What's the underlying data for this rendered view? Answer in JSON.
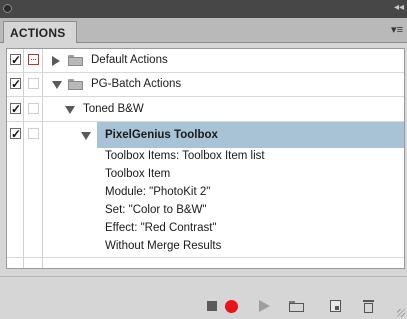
{
  "panel": {
    "tab_label": "ACTIONS",
    "collapse_glyph": "◂◂",
    "menu_glyph": "▾≡"
  },
  "rows": [
    {
      "label": "Default Actions",
      "checked": true,
      "dialog": "red",
      "expanded": false,
      "type": "set"
    },
    {
      "label": "PG-Batch Actions",
      "checked": true,
      "dialog": "empty",
      "expanded": true,
      "type": "set"
    },
    {
      "label": "Toned B&W",
      "checked": true,
      "dialog": "empty",
      "expanded": true,
      "type": "action"
    },
    {
      "label": "PixelGenius Toolbox",
      "checked": true,
      "dialog": "empty",
      "expanded": true,
      "type": "step",
      "selected": true
    },
    {
      "label": "Toolbox Items: Toolbox Item list",
      "type": "detail"
    },
    {
      "label": "Toolbox Item",
      "type": "detail"
    },
    {
      "label": "Module:  \"PhotoKit 2\"",
      "type": "detail"
    },
    {
      "label": "Set:  \"Color to B&W\"",
      "type": "detail"
    },
    {
      "label": "Effect:  \"Red Contrast\"",
      "type": "detail"
    },
    {
      "label": "Without Merge Results",
      "type": "detail"
    }
  ],
  "toolbar": {
    "stop_icon": "stop-icon",
    "record_icon": "record-icon",
    "play_icon": "play-icon",
    "new_set_icon": "folder-icon",
    "new_action_icon": "new-action-icon",
    "delete_icon": "trash-icon",
    "record_color": "#e8141c"
  }
}
